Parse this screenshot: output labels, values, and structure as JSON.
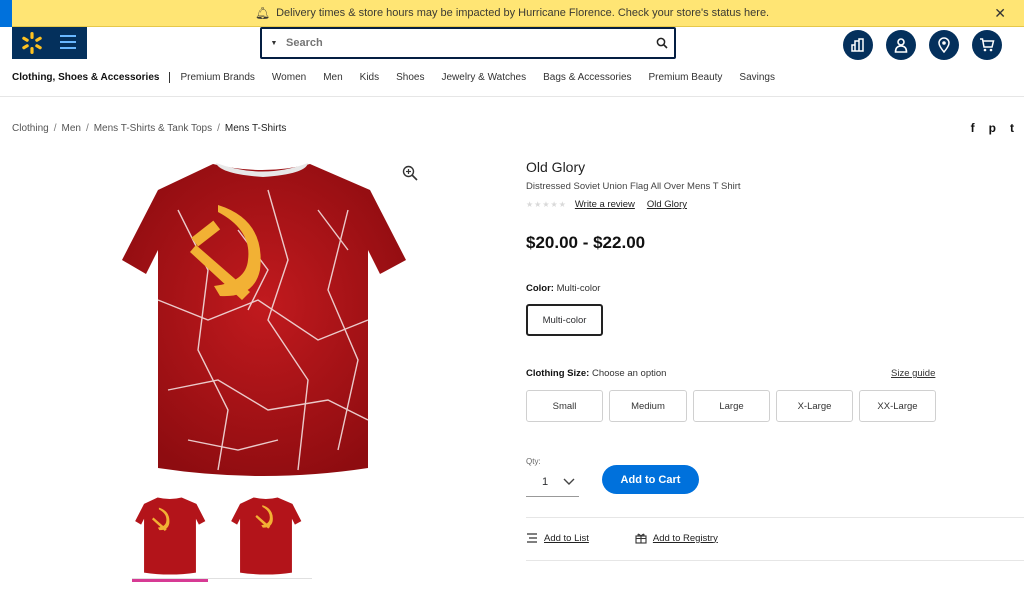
{
  "alert": {
    "message": "Delivery times & store hours may be impacted by Hurricane Florence. Check your store's status here."
  },
  "search": {
    "placeholder": "Search"
  },
  "nav": {
    "items": [
      "Clothing, Shoes & Accessories",
      "Premium Brands",
      "Women",
      "Men",
      "Kids",
      "Shoes",
      "Jewelry & Watches",
      "Bags & Accessories",
      "Premium Beauty",
      "Savings"
    ]
  },
  "breadcrumb": [
    "Clothing",
    "Men",
    "Mens T-Shirts & Tank Tops",
    "Mens T-Shirts"
  ],
  "social": [
    "f",
    "p",
    "t"
  ],
  "product": {
    "brand": "Old Glory",
    "title": "Distressed Soviet Union Flag All Over Mens T Shirt",
    "write_review": "Write a review",
    "brand_link": "Old Glory",
    "price": "$20.00 - $22.00",
    "color_label": "Color:",
    "color_value": "Multi-color",
    "color_option": "Multi-color",
    "size_label": "Clothing Size:",
    "size_value": "Choose an option",
    "size_guide": "Size guide",
    "sizes": [
      "Small",
      "Medium",
      "Large",
      "X-Large",
      "XX-Large"
    ],
    "qty_label": "Qty:",
    "qty_value": "1",
    "add_to_cart": "Add to Cart",
    "add_to_list": "Add to List",
    "add_to_registry": "Add to Registry"
  },
  "colors": {
    "accent": "#0071dc",
    "brand_navy": "#04305c",
    "alert_bg": "#ffe574",
    "shirt_red": "#b3141a",
    "emblem": "#f2b134",
    "thumb_active": "#d73a94"
  }
}
